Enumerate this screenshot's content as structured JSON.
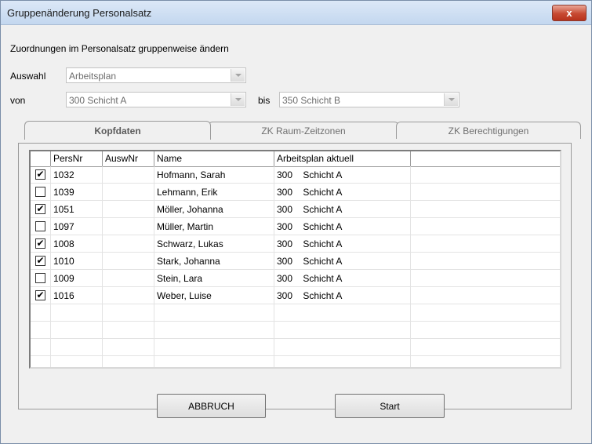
{
  "window": {
    "title": "Gruppenänderung Personalsatz",
    "close": "x"
  },
  "subtitle": "Zuordnungen im Personalsatz gruppenweise ändern",
  "auswahl": {
    "label": "Auswahl",
    "value": "Arbeitsplan"
  },
  "von": {
    "label": "von",
    "value": "300  Schicht A"
  },
  "bis": {
    "label": "bis",
    "value": "350  Schicht B"
  },
  "tabs": [
    "Kopfdaten",
    "ZK Raum-Zeitzonen",
    "ZK Berechtigungen"
  ],
  "grid": {
    "headers": [
      "",
      "PersNr",
      "AuswNr",
      "Name",
      "Arbeitsplan  aktuell",
      ""
    ],
    "rows": [
      {
        "checked": "✔",
        "persnr": "1032",
        "auswnr": "",
        "name": "Hofmann, Sarah",
        "plan": "300    Schicht A"
      },
      {
        "checked": "",
        "persnr": "1039",
        "auswnr": "",
        "name": "Lehmann, Erik",
        "plan": "300    Schicht A"
      },
      {
        "checked": "✔",
        "persnr": "1051",
        "auswnr": "",
        "name": "Möller, Johanna",
        "plan": "300    Schicht A"
      },
      {
        "checked": "",
        "persnr": "1097",
        "auswnr": "",
        "name": "Müller, Martin",
        "plan": "300    Schicht A"
      },
      {
        "checked": "✔",
        "persnr": "1008",
        "auswnr": "",
        "name": "Schwarz, Lukas",
        "plan": "300    Schicht A"
      },
      {
        "checked": "✔",
        "persnr": "1010",
        "auswnr": "",
        "name": "Stark, Johanna",
        "plan": "300    Schicht A"
      },
      {
        "checked": "",
        "persnr": "1009",
        "auswnr": "",
        "name": "Stein, Lara",
        "plan": "300    Schicht A"
      },
      {
        "checked": "✔",
        "persnr": "1016",
        "auswnr": "",
        "name": "Weber, Luise",
        "plan": "300    Schicht A"
      }
    ]
  },
  "buttons": {
    "cancel": "ABBRUCH",
    "start": "Start"
  }
}
